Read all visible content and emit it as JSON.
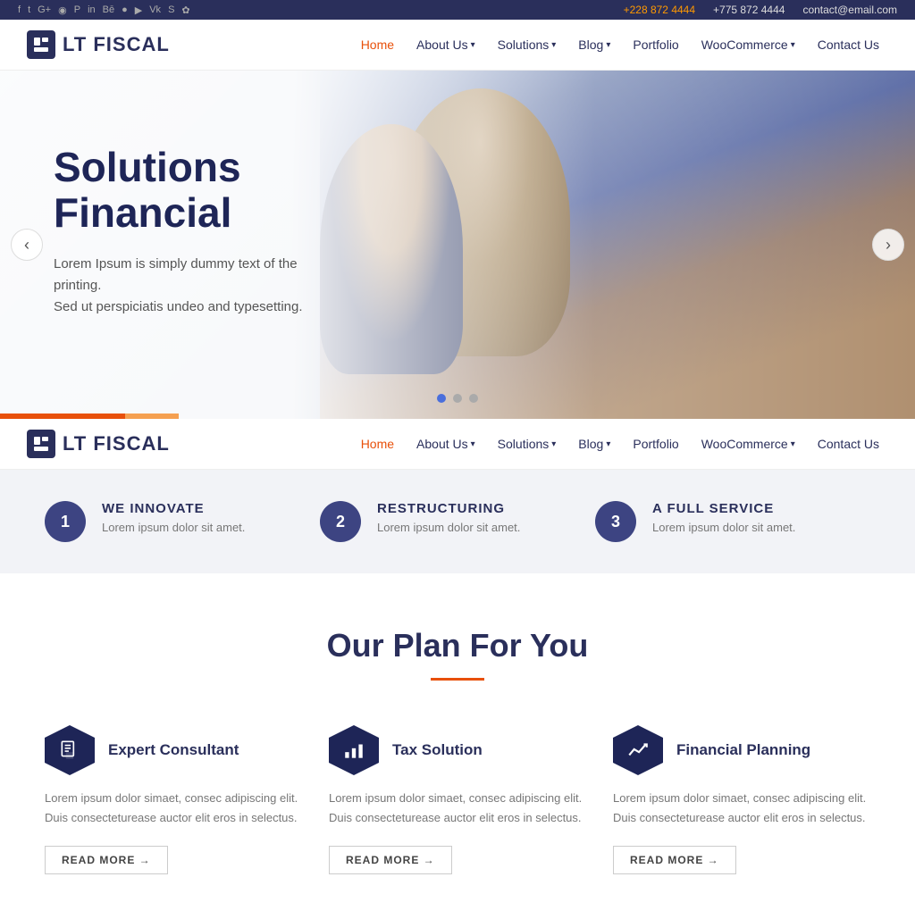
{
  "topbar": {
    "phone1": "+228 872 4444",
    "phone2": "+775 872 4444",
    "email": "contact@email.com",
    "social_icons": [
      "fb",
      "tw",
      "g+",
      "rss",
      "pin",
      "li",
      "be",
      "be2",
      "drib",
      "yt",
      "vk",
      "sk",
      "wp"
    ]
  },
  "header": {
    "logo_text": "LT FISCAL",
    "nav": {
      "home": "Home",
      "about": "About Us",
      "solutions": "Solutions",
      "blog": "Blog",
      "portfolio": "Portfolio",
      "woocommerce": "WooCommerce",
      "contact": "Contact Us"
    }
  },
  "hero": {
    "title_line1": "Solutions",
    "title_line2": "Financial",
    "subtitle": "Lorem Ipsum is simply dummy text of the printing.",
    "subtitle2": "Sed ut perspiciatis undeo and typesetting.",
    "prev_label": "‹",
    "next_label": "›"
  },
  "features": [
    {
      "number": "1",
      "title": "WE INNOVATE",
      "desc": "Lorem ipsum dolor sit amet."
    },
    {
      "number": "2",
      "title": "RESTRUCTURING",
      "desc": "Lorem ipsum dolor sit amet."
    },
    {
      "number": "3",
      "title": "A FULL SERVICE",
      "desc": "Lorem ipsum dolor sit amet."
    }
  ],
  "plan_section": {
    "heading": "Our Plan For You",
    "cards": [
      {
        "icon": "consultant",
        "title": "Expert Consultant",
        "desc": "Lorem ipsum dolor simaet, consec adipiscing elit. Duis consecteturease auctor elit eros in selectus.",
        "read_more": "READ MORE →"
      },
      {
        "icon": "tax",
        "title": "Tax Solution",
        "desc": "Lorem ipsum dolor simaet, consec adipiscing elit. Duis consecteturease auctor elit eros in selectus.",
        "read_more": "READ MORE →"
      },
      {
        "icon": "financial",
        "title": "Financial Planning",
        "desc": "Lorem ipsum dolor simaet, consec adipiscing elit. Duis consecteturease auctor elit eros in selectus.",
        "read_more": "READ MORE →"
      }
    ]
  }
}
